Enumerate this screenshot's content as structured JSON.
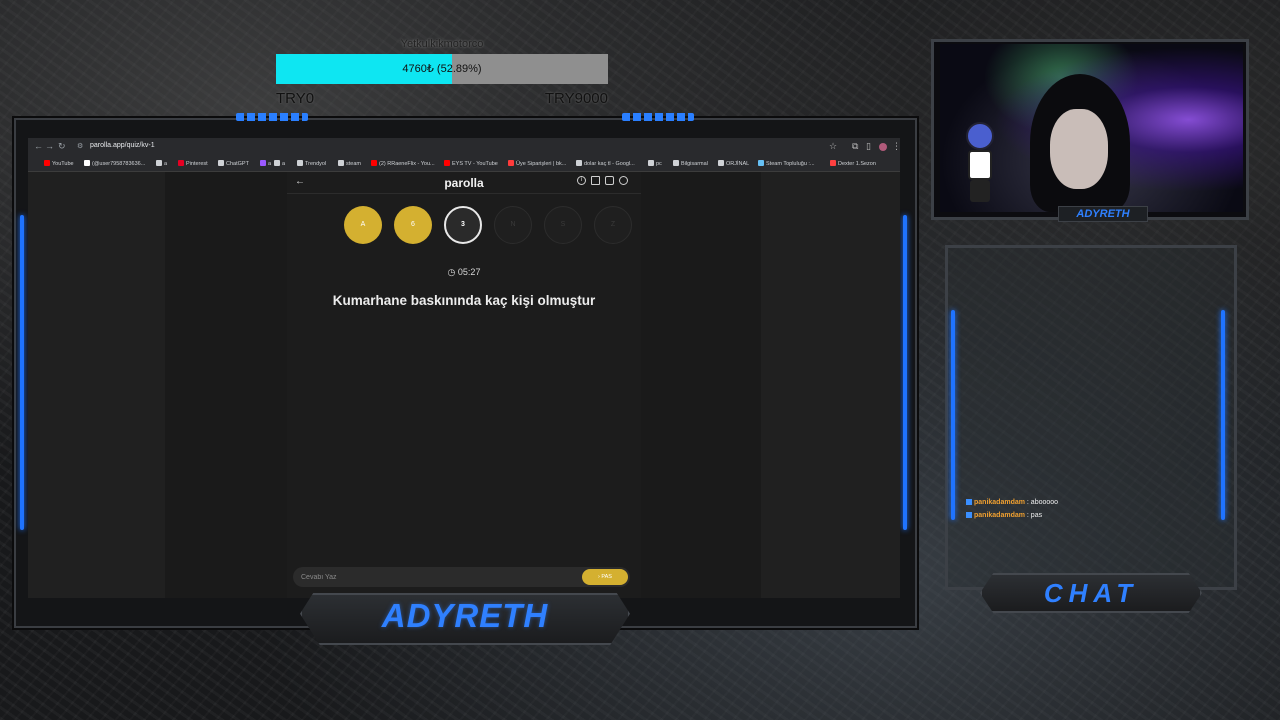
{
  "goal": {
    "title": "Yetkulkikmotorco",
    "amount": "4760₺ (52.89%)",
    "progress": 0.5289,
    "min_label": "TRY0",
    "max_label": "TRY9000",
    "fill_color": "#0ee6f2"
  },
  "browser": {
    "url": "parolla.app/quiz/kv-1",
    "bookmarks": [
      {
        "label": "YouTube",
        "icon": "youtube-icon",
        "color": "#ff0000"
      },
      {
        "label": "(@user7958783636...",
        "icon": "tiktok-icon",
        "color": "#ffffff"
      },
      {
        "label": "a",
        "icon": "folder-icon",
        "color": "#cfd2d6"
      },
      {
        "label": "Pinterest",
        "icon": "pinterest-icon",
        "color": "#e60023"
      },
      {
        "label": "ChatGPT",
        "icon": "chatgpt-icon",
        "color": "#cfd2d6"
      },
      {
        "label": "a",
        "icon": "bookmark-icon",
        "color": "#9b59ff"
      },
      {
        "label": "a",
        "icon": "folder-icon",
        "color": "#cfd2d6"
      },
      {
        "label": "Trendyol",
        "icon": "folder-icon",
        "color": "#cfd2d6"
      },
      {
        "label": "steam",
        "icon": "folder-icon",
        "color": "#cfd2d6"
      },
      {
        "label": "(2) RRaeneFlix - You...",
        "icon": "youtube-icon",
        "color": "#ff0000"
      },
      {
        "label": "EYS TV - YouTube",
        "icon": "youtube-icon",
        "color": "#ff0000"
      },
      {
        "label": "Üye Siparişleri | bk...",
        "icon": "shop-icon",
        "color": "#ff3b3b"
      },
      {
        "label": "dolar kaç tl - Googl...",
        "icon": "google-icon",
        "color": "#cfd2d6"
      },
      {
        "label": "pc",
        "icon": "folder-icon",
        "color": "#cfd2d6"
      },
      {
        "label": "Bilgisarmal",
        "icon": "globe-icon",
        "color": "#cfd2d6"
      },
      {
        "label": "ORJİNAL",
        "icon": "globe-icon",
        "color": "#cfd2d6"
      },
      {
        "label": "Steam Topluluğu :...",
        "icon": "steam-icon",
        "color": "#66c0f4"
      },
      {
        "label": "Dexter 1.Sezon",
        "icon": "dexter-icon",
        "color": "#ff4040"
      }
    ]
  },
  "app": {
    "title": "parolla",
    "letters": [
      {
        "char": "A",
        "state": "done"
      },
      {
        "char": "6",
        "state": "done"
      },
      {
        "char": "3",
        "state": "current"
      },
      {
        "char": "N",
        "state": "todo"
      },
      {
        "char": "S",
        "state": "todo"
      },
      {
        "char": "Z",
        "state": "todo"
      }
    ],
    "timer": "05:27",
    "question": "Kumarhane baskınında kaç kişi olmuştur",
    "answer_placeholder": "Cevabı Yaz",
    "pass_label": "PAS",
    "accent_color": "#d4b030"
  },
  "stream": {
    "brand": "ADYRETH",
    "cam_label": "ADYRETH",
    "chat_title": "CHAT",
    "accent_color": "#2f80ff"
  },
  "chat": {
    "messages": [
      {
        "user": "panikadamdam",
        "text": ": abooooo"
      },
      {
        "user": "panikadamdam",
        "text": ": pas"
      }
    ]
  }
}
